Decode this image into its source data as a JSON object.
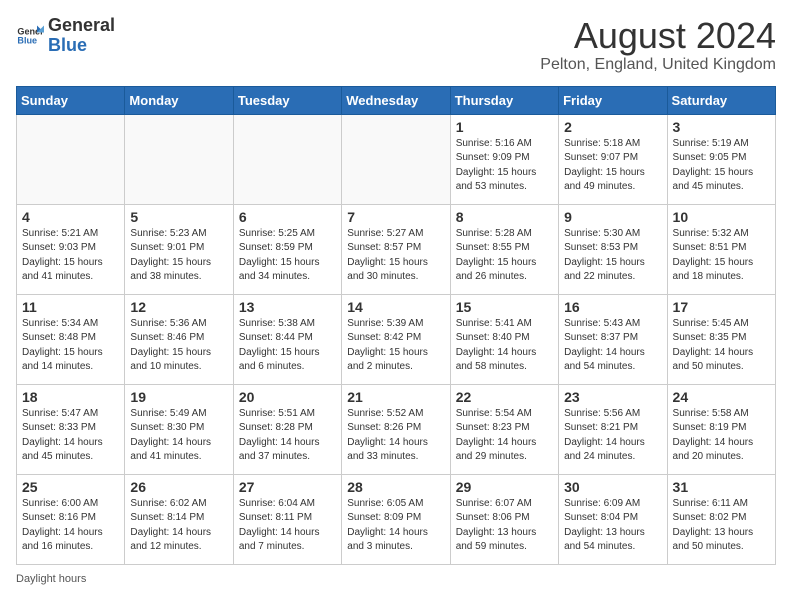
{
  "header": {
    "logo_general": "General",
    "logo_blue": "Blue",
    "month_title": "August 2024",
    "location": "Pelton, England, United Kingdom"
  },
  "days_of_week": [
    "Sunday",
    "Monday",
    "Tuesday",
    "Wednesday",
    "Thursday",
    "Friday",
    "Saturday"
  ],
  "weeks": [
    [
      {
        "day": "",
        "info": ""
      },
      {
        "day": "",
        "info": ""
      },
      {
        "day": "",
        "info": ""
      },
      {
        "day": "",
        "info": ""
      },
      {
        "day": "1",
        "info": "Sunrise: 5:16 AM\nSunset: 9:09 PM\nDaylight: 15 hours\nand 53 minutes."
      },
      {
        "day": "2",
        "info": "Sunrise: 5:18 AM\nSunset: 9:07 PM\nDaylight: 15 hours\nand 49 minutes."
      },
      {
        "day": "3",
        "info": "Sunrise: 5:19 AM\nSunset: 9:05 PM\nDaylight: 15 hours\nand 45 minutes."
      }
    ],
    [
      {
        "day": "4",
        "info": "Sunrise: 5:21 AM\nSunset: 9:03 PM\nDaylight: 15 hours\nand 41 minutes."
      },
      {
        "day": "5",
        "info": "Sunrise: 5:23 AM\nSunset: 9:01 PM\nDaylight: 15 hours\nand 38 minutes."
      },
      {
        "day": "6",
        "info": "Sunrise: 5:25 AM\nSunset: 8:59 PM\nDaylight: 15 hours\nand 34 minutes."
      },
      {
        "day": "7",
        "info": "Sunrise: 5:27 AM\nSunset: 8:57 PM\nDaylight: 15 hours\nand 30 minutes."
      },
      {
        "day": "8",
        "info": "Sunrise: 5:28 AM\nSunset: 8:55 PM\nDaylight: 15 hours\nand 26 minutes."
      },
      {
        "day": "9",
        "info": "Sunrise: 5:30 AM\nSunset: 8:53 PM\nDaylight: 15 hours\nand 22 minutes."
      },
      {
        "day": "10",
        "info": "Sunrise: 5:32 AM\nSunset: 8:51 PM\nDaylight: 15 hours\nand 18 minutes."
      }
    ],
    [
      {
        "day": "11",
        "info": "Sunrise: 5:34 AM\nSunset: 8:48 PM\nDaylight: 15 hours\nand 14 minutes."
      },
      {
        "day": "12",
        "info": "Sunrise: 5:36 AM\nSunset: 8:46 PM\nDaylight: 15 hours\nand 10 minutes."
      },
      {
        "day": "13",
        "info": "Sunrise: 5:38 AM\nSunset: 8:44 PM\nDaylight: 15 hours\nand 6 minutes."
      },
      {
        "day": "14",
        "info": "Sunrise: 5:39 AM\nSunset: 8:42 PM\nDaylight: 15 hours\nand 2 minutes."
      },
      {
        "day": "15",
        "info": "Sunrise: 5:41 AM\nSunset: 8:40 PM\nDaylight: 14 hours\nand 58 minutes."
      },
      {
        "day": "16",
        "info": "Sunrise: 5:43 AM\nSunset: 8:37 PM\nDaylight: 14 hours\nand 54 minutes."
      },
      {
        "day": "17",
        "info": "Sunrise: 5:45 AM\nSunset: 8:35 PM\nDaylight: 14 hours\nand 50 minutes."
      }
    ],
    [
      {
        "day": "18",
        "info": "Sunrise: 5:47 AM\nSunset: 8:33 PM\nDaylight: 14 hours\nand 45 minutes."
      },
      {
        "day": "19",
        "info": "Sunrise: 5:49 AM\nSunset: 8:30 PM\nDaylight: 14 hours\nand 41 minutes."
      },
      {
        "day": "20",
        "info": "Sunrise: 5:51 AM\nSunset: 8:28 PM\nDaylight: 14 hours\nand 37 minutes."
      },
      {
        "day": "21",
        "info": "Sunrise: 5:52 AM\nSunset: 8:26 PM\nDaylight: 14 hours\nand 33 minutes."
      },
      {
        "day": "22",
        "info": "Sunrise: 5:54 AM\nSunset: 8:23 PM\nDaylight: 14 hours\nand 29 minutes."
      },
      {
        "day": "23",
        "info": "Sunrise: 5:56 AM\nSunset: 8:21 PM\nDaylight: 14 hours\nand 24 minutes."
      },
      {
        "day": "24",
        "info": "Sunrise: 5:58 AM\nSunset: 8:19 PM\nDaylight: 14 hours\nand 20 minutes."
      }
    ],
    [
      {
        "day": "25",
        "info": "Sunrise: 6:00 AM\nSunset: 8:16 PM\nDaylight: 14 hours\nand 16 minutes."
      },
      {
        "day": "26",
        "info": "Sunrise: 6:02 AM\nSunset: 8:14 PM\nDaylight: 14 hours\nand 12 minutes."
      },
      {
        "day": "27",
        "info": "Sunrise: 6:04 AM\nSunset: 8:11 PM\nDaylight: 14 hours\nand 7 minutes."
      },
      {
        "day": "28",
        "info": "Sunrise: 6:05 AM\nSunset: 8:09 PM\nDaylight: 14 hours\nand 3 minutes."
      },
      {
        "day": "29",
        "info": "Sunrise: 6:07 AM\nSunset: 8:06 PM\nDaylight: 13 hours\nand 59 minutes."
      },
      {
        "day": "30",
        "info": "Sunrise: 6:09 AM\nSunset: 8:04 PM\nDaylight: 13 hours\nand 54 minutes."
      },
      {
        "day": "31",
        "info": "Sunrise: 6:11 AM\nSunset: 8:02 PM\nDaylight: 13 hours\nand 50 minutes."
      }
    ]
  ],
  "footer": {
    "daylight_hours_label": "Daylight hours"
  }
}
